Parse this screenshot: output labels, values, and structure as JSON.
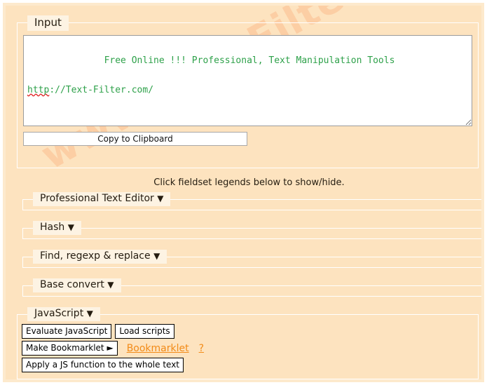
{
  "colors": {
    "page_background": "#fde3bf",
    "outer_frame": "#fdeacd",
    "legend_background": "#fdf3e3",
    "fieldset_border": "#ffffff",
    "input_text": "#2ea14a",
    "link_orange": "#f28b18",
    "watermark": "#fcc69a",
    "misspell_underline": "#e02020"
  },
  "watermark": {
    "text": "www.Text-Filter.com"
  },
  "input_section": {
    "legend": "Input",
    "textarea": {
      "line1_misspelled": "",
      "line1": "Free Online !!! Professional, Text Manipulation Tools",
      "line2_misspelled": "http",
      "line2_rest": "://Text-Filter.com/",
      "value": "Free Online !!! Professional, Text Manipulation Tools\n\nhttp://Text-Filter.com/"
    },
    "copy_button": "Copy to Clipboard"
  },
  "hint": "Click fieldset legends below to show/hide.",
  "caret_down": "▼",
  "caret_right": "►",
  "sections": [
    {
      "legend": "Professional Text Editor",
      "state": "collapsed"
    },
    {
      "legend": "Hash",
      "state": "collapsed"
    },
    {
      "legend": "Find, regexp & replace",
      "state": "collapsed"
    },
    {
      "legend": "Base convert",
      "state": "collapsed"
    }
  ],
  "javascript_section": {
    "legend": "JavaScript",
    "state": "expanded",
    "buttons": [
      {
        "label": "Evaluate JavaScript"
      },
      {
        "label": "Load scripts"
      },
      {
        "label": "Make Bookmarklet ►"
      },
      {
        "label": "Apply a JS function to the whole text"
      }
    ],
    "bookmarklet_link": "Bookmarklet",
    "help_link": "?"
  }
}
